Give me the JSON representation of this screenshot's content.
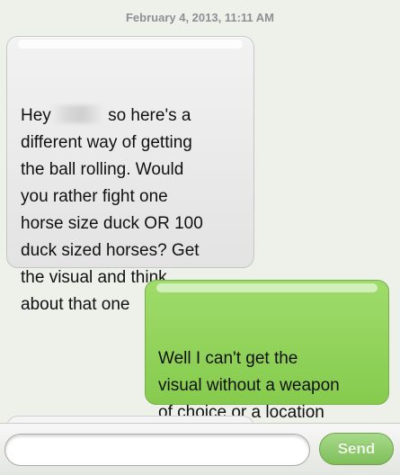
{
  "thread": {
    "timestamp": "February 4, 2013, 11:11 AM",
    "messages": [
      {
        "direction": "incoming",
        "text_before_redaction": "Hey",
        "text_after_redaction": " so here's a\ndifferent way of getting\nthe ball rolling. Would\nyou rather fight one\nhorse size duck OR 100\nduck sized horses? Get\nthe visual and think\nabout that one"
      },
      {
        "direction": "outgoing",
        "text": "Well I can't get the\nvisual without a weapon\nof choice or a location\nof said battle"
      }
    ]
  },
  "composer": {
    "input_value": "",
    "input_placeholder": "",
    "send_label": "Send"
  },
  "colors": {
    "incoming_bubble": "#e8e8e8",
    "outgoing_bubble": "#93d45c",
    "background": "#eef0ea",
    "send_button": "#8cc76a"
  }
}
